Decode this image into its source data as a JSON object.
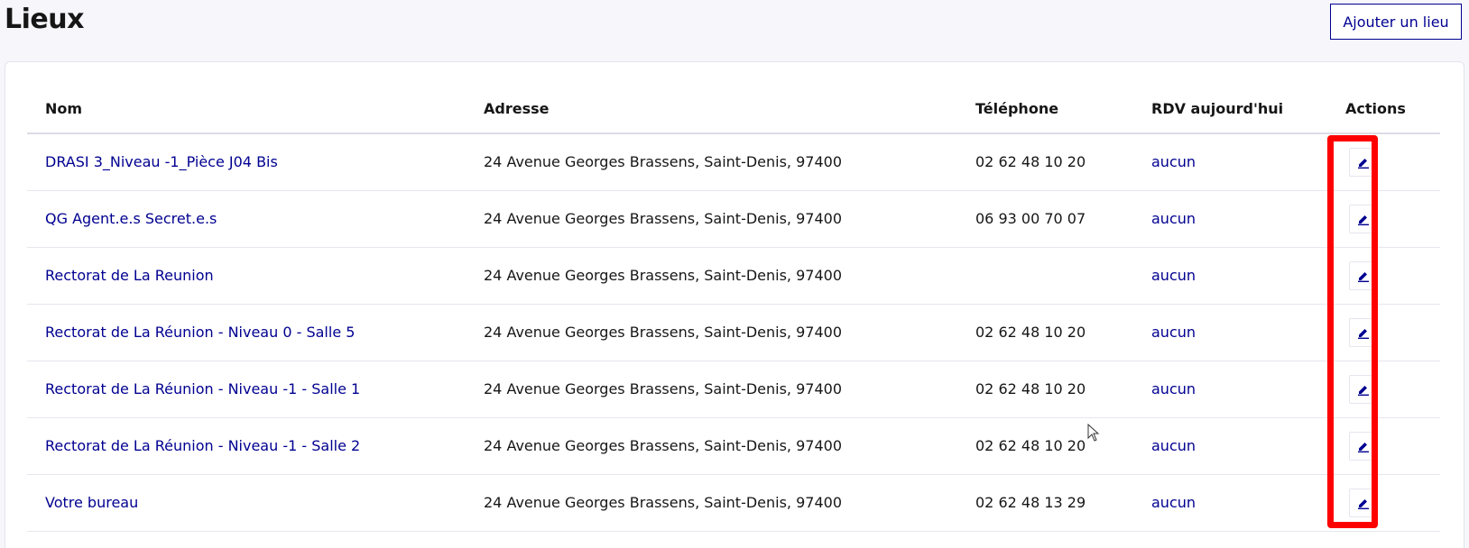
{
  "page": {
    "title": "Lieux"
  },
  "toolbar": {
    "add_label": "Ajouter un lieu"
  },
  "table": {
    "headers": {
      "nom": "Nom",
      "adresse": "Adresse",
      "telephone": "Téléphone",
      "rdv": "RDV aujourd'hui",
      "actions": "Actions"
    },
    "rows": [
      {
        "nom": "DRASI 3_Niveau -1_Pièce J04 Bis",
        "adresse": "24 Avenue Georges Brassens, Saint-Denis, 97400",
        "telephone": "02 62 48 10 20",
        "rdv": "aucun"
      },
      {
        "nom": "QG Agent.e.s Secret.e.s",
        "adresse": "24 Avenue Georges Brassens, Saint-Denis, 97400",
        "telephone": "06 93 00 70 07",
        "rdv": "aucun"
      },
      {
        "nom": "Rectorat de La Reunion",
        "adresse": "24 Avenue Georges Brassens, Saint-Denis, 97400",
        "telephone": "",
        "rdv": "aucun"
      },
      {
        "nom": "Rectorat de La Réunion - Niveau 0 - Salle 5",
        "adresse": "24 Avenue Georges Brassens, Saint-Denis, 97400",
        "telephone": "02 62 48 10 20",
        "rdv": "aucun"
      },
      {
        "nom": "Rectorat de La Réunion - Niveau -1 - Salle 1",
        "adresse": "24 Avenue Georges Brassens, Saint-Denis, 97400",
        "telephone": "02 62 48 10 20",
        "rdv": "aucun"
      },
      {
        "nom": "Rectorat de La Réunion - Niveau -1 - Salle 2",
        "adresse": "24 Avenue Georges Brassens, Saint-Denis, 97400",
        "telephone": "02 62 48 10 20",
        "rdv": "aucun"
      },
      {
        "nom": "Votre bureau",
        "adresse": "24 Avenue Georges Brassens, Saint-Denis, 97400",
        "telephone": "02 62 48 13 29",
        "rdv": "aucun"
      }
    ]
  },
  "icons": {
    "edit": "pencil-icon"
  },
  "colors": {
    "link": "#000091",
    "highlight": "#ff0000",
    "background": "#f6f6fb"
  }
}
